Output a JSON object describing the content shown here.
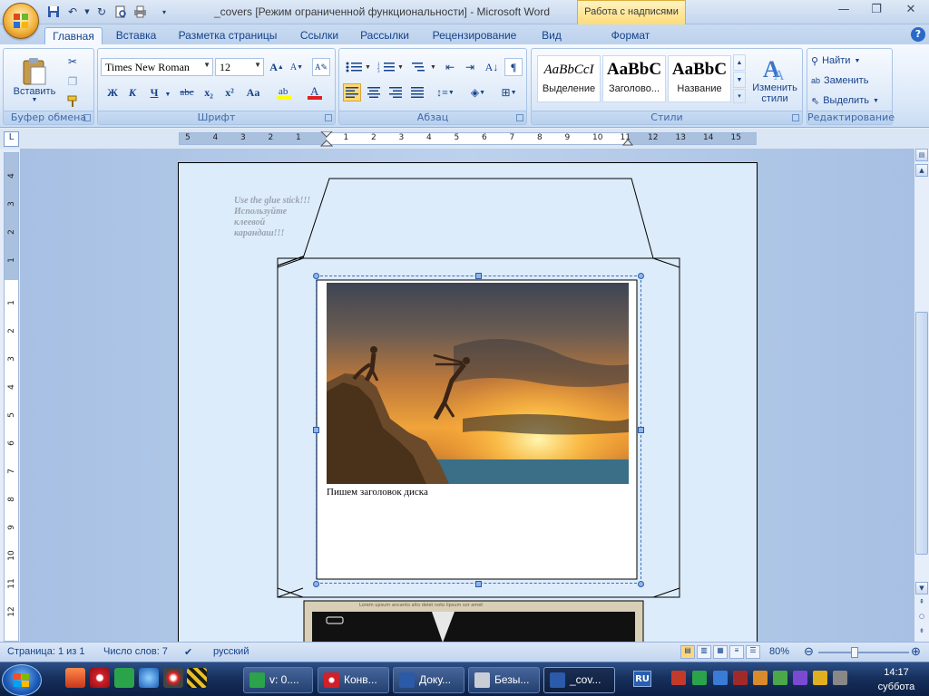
{
  "window": {
    "title": "_covers [Режим ограниченной функциональности] - Microsoft Word",
    "contextual_tools": "Работа с надписями"
  },
  "tabs": [
    "Главная",
    "Вставка",
    "Разметка страницы",
    "Ссылки",
    "Рассылки",
    "Рецензирование",
    "Вид",
    "Формат"
  ],
  "ribbon": {
    "clipboard": {
      "paste_label": "Вставить",
      "group_label": "Буфер обмена"
    },
    "font": {
      "font_name": "Times New Roman",
      "font_size": "12",
      "group_label": "Шрифт",
      "bold": "Ж",
      "italic": "К",
      "underline": "Ч",
      "strike": "abc",
      "subscript": "x₂",
      "superscript": "x²",
      "case": "Aa"
    },
    "paragraph": {
      "group_label": "Абзац"
    },
    "styles": {
      "group_label": "Стили",
      "items": [
        {
          "preview": "AaBbCcI",
          "name": "Выделение"
        },
        {
          "preview": "AaBbC",
          "name": "Заголово..."
        },
        {
          "preview": "AaBbC",
          "name": "Название"
        }
      ],
      "change_styles": "Изменить стили"
    },
    "editing": {
      "group_label": "Редактирование",
      "find": "Найти",
      "replace": "Заменить",
      "select": "Выделить"
    }
  },
  "ruler": {
    "ticks": [
      "5",
      "4",
      "3",
      "2",
      "1",
      "1",
      "2",
      "3",
      "4",
      "5",
      "6",
      "7",
      "8",
      "9",
      "10",
      "11",
      "12",
      "13",
      "14",
      "15"
    ]
  },
  "document": {
    "glue_note": [
      "Use the glue stick!!!",
      "Используйте",
      "клеевой",
      "карандаш!!!"
    ],
    "caption": "Пишем заголовок диска"
  },
  "statusbar": {
    "page": "Страница: 1 из 1",
    "words": "Число слов: 7",
    "language": "русский",
    "zoom": "80%",
    "zoom_level": 0.8
  },
  "taskbar": {
    "tasks": [
      "v: 0....",
      "Конв...",
      "Доку...",
      "Безы...",
      "_cov..."
    ],
    "lang": "RU",
    "time": "14:17",
    "day": "суббота"
  }
}
